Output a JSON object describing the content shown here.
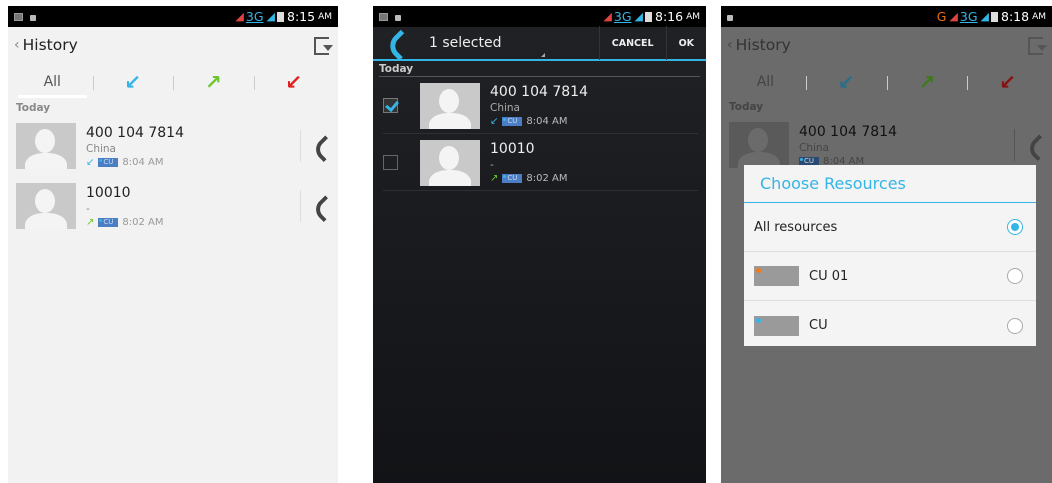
{
  "screen1": {
    "status": {
      "signal1": "◢",
      "network": "3G",
      "signal2": "◢",
      "time": "8:15",
      "ampm": "AM"
    },
    "title": "History",
    "tabs": {
      "all": "All",
      "incoming": "↙",
      "outgoing": "↗",
      "missed": "↙"
    },
    "section": "Today",
    "calls": [
      {
        "number": "400 104 7814",
        "location": "China",
        "direction": "↙",
        "sim": "CU",
        "time": "8:04 AM"
      },
      {
        "number": "10010",
        "location": "-",
        "direction": "↗",
        "sim": "CU",
        "time": "8:02 AM"
      }
    ]
  },
  "screen2": {
    "status": {
      "signal1": "◢",
      "network": "3G",
      "signal2": "◢",
      "time": "8:16",
      "ampm": "AM"
    },
    "selected_label": "1 selected",
    "cancel": "CANCEL",
    "ok": "OK",
    "section": "Today",
    "calls": [
      {
        "number": "400 104 7814",
        "location": "China",
        "direction": "↙",
        "sim": "CU",
        "time": "8:04 AM",
        "checked": true
      },
      {
        "number": "10010",
        "location": "-",
        "direction": "↗",
        "sim": "CU",
        "time": "8:02 AM",
        "checked": false
      }
    ]
  },
  "screen3": {
    "status": {
      "g": "G",
      "signal1": "◢",
      "network": "3G",
      "signal2": "◢",
      "time": "8:18",
      "ampm": "AM"
    },
    "title": "History",
    "tabs": {
      "all": "All",
      "incoming": "↙",
      "outgoing": "↗",
      "missed": "↙"
    },
    "section": "Today",
    "call": {
      "number": "400 104 7814",
      "location": "China",
      "sim": "CU",
      "time": "8:04 AM"
    },
    "dialog": {
      "title": "Choose Resources",
      "options": [
        {
          "label": "All resources",
          "selected": true
        },
        {
          "label": "CU 01",
          "selected": false,
          "dot_color": "#f07a1a"
        },
        {
          "label": "CU",
          "selected": false,
          "dot_color": "#33b5e5"
        }
      ]
    }
  },
  "colors": {
    "accent": "#33b5e5",
    "incoming": "#33b5e5",
    "outgoing": "#6cc72a",
    "missed": "#e02020"
  }
}
